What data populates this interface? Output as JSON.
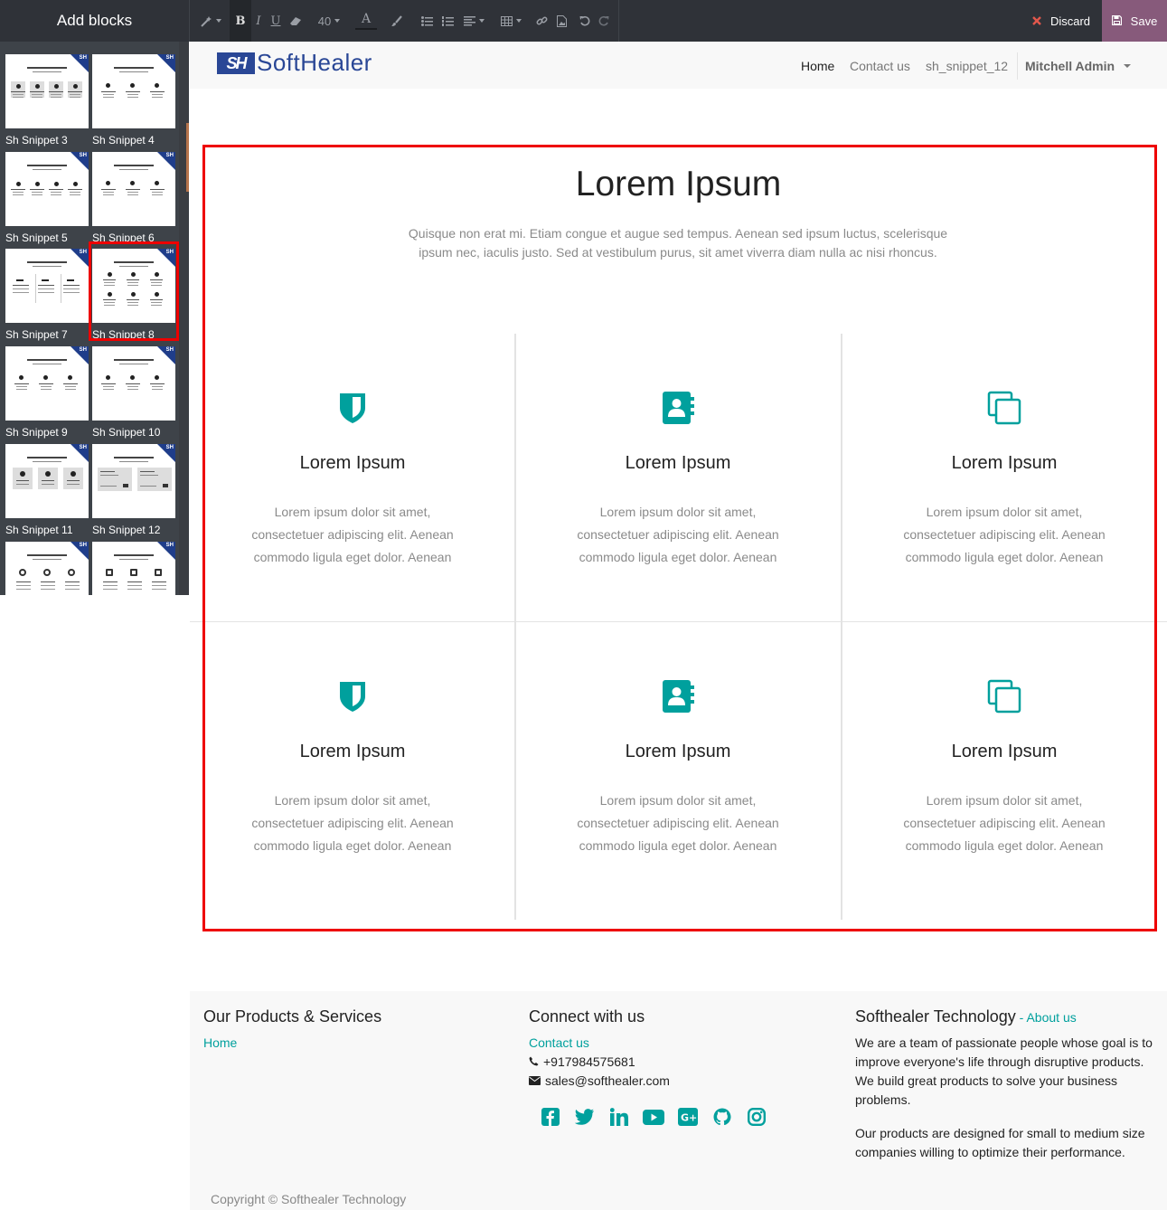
{
  "editor": {
    "panel_title": "Add blocks",
    "font_size": "40",
    "discard_label": "Discard",
    "save_label": "Save",
    "bold_glyph": "B",
    "italic_glyph": "I",
    "underline_glyph": "U",
    "font_color_glyph": "A"
  },
  "snippets": [
    {
      "label": "Sh Snippet 3",
      "corner": "SH"
    },
    {
      "label": "Sh Snippet 4",
      "corner": "SH"
    },
    {
      "label": "Sh Snippet 5",
      "corner": "SH"
    },
    {
      "label": "Sh Snippet 6",
      "corner": "SH"
    },
    {
      "label": "Sh Snippet 7",
      "corner": "SH"
    },
    {
      "label": "Sh Snippet 8",
      "corner": "SH"
    },
    {
      "label": "Sh Snippet 9",
      "corner": "SH"
    },
    {
      "label": "Sh Snippet 10",
      "corner": "SH"
    },
    {
      "label": "Sh Snippet 11",
      "corner": "SH"
    },
    {
      "label": "Sh Snippet 12",
      "corner": "SH"
    },
    {
      "label": "",
      "corner": "SH"
    },
    {
      "label": "",
      "corner": "SH"
    }
  ],
  "site": {
    "logo_mark": "SH",
    "logo_text": "SoftHealer",
    "nav": {
      "home": "Home",
      "contact": "Contact us",
      "snippet": "sh_snippet_12",
      "user": "Mitchell Admin"
    },
    "block": {
      "title": "Lorem Ipsum",
      "subtitle": "Quisque non erat mi. Etiam congue et augue sed tempus. Aenean sed ipsum luctus, scelerisque ipsum nec, iaculis justo. Sed at vestibulum purus, sit amet viverra diam nulla ac nisi rhoncus.",
      "features": [
        {
          "icon": "shield-icon",
          "title": "Lorem Ipsum",
          "text": "Lorem ipsum dolor sit amet, consectetuer adipiscing elit. Aenean commodo ligula eget dolor. Aenean"
        },
        {
          "icon": "address-book-icon",
          "title": "Lorem Ipsum",
          "text": "Lorem ipsum dolor sit amet, consectetuer adipiscing elit. Aenean commodo ligula eget dolor. Aenean"
        },
        {
          "icon": "copy-icon",
          "title": "Lorem Ipsum",
          "text": "Lorem ipsum dolor sit amet, consectetuer adipiscing elit. Aenean commodo ligula eget dolor. Aenean"
        },
        {
          "icon": "shield-icon",
          "title": "Lorem Ipsum",
          "text": "Lorem ipsum dolor sit amet, consectetuer adipiscing elit. Aenean commodo ligula eget dolor. Aenean"
        },
        {
          "icon": "address-book-icon",
          "title": "Lorem Ipsum",
          "text": "Lorem ipsum dolor sit amet, consectetuer adipiscing elit. Aenean commodo ligula eget dolor. Aenean"
        },
        {
          "icon": "copy-icon",
          "title": "Lorem Ipsum",
          "text": "Lorem ipsum dolor sit amet, consectetuer adipiscing elit. Aenean commodo ligula eget dolor. Aenean"
        }
      ]
    },
    "footer": {
      "col1_title": "Our Products & Services",
      "col1_link": "Home",
      "col2_title": "Connect with us",
      "col2_link": "Contact us",
      "phone": "+917984575681",
      "email": "sales@softhealer.com",
      "col3_title": "Softhealer Technology",
      "col3_about": "About us",
      "col3_para1": "We are a team of passionate people whose goal is to improve everyone's life through disruptive products. We build great products to solve your business problems.",
      "col3_para2": "Our products are designed for small to medium size companies willing to optimize their performance.",
      "copyright": "Copyright © Softhealer Technology",
      "socials": [
        "facebook-icon",
        "twitter-icon",
        "linkedin-icon",
        "youtube-icon",
        "google-plus-icon",
        "github-icon",
        "instagram-icon"
      ]
    }
  },
  "colors": {
    "accent": "#00a09d",
    "brand": "#2a4796",
    "save": "#875a7b",
    "highlight": "#ee0000"
  }
}
